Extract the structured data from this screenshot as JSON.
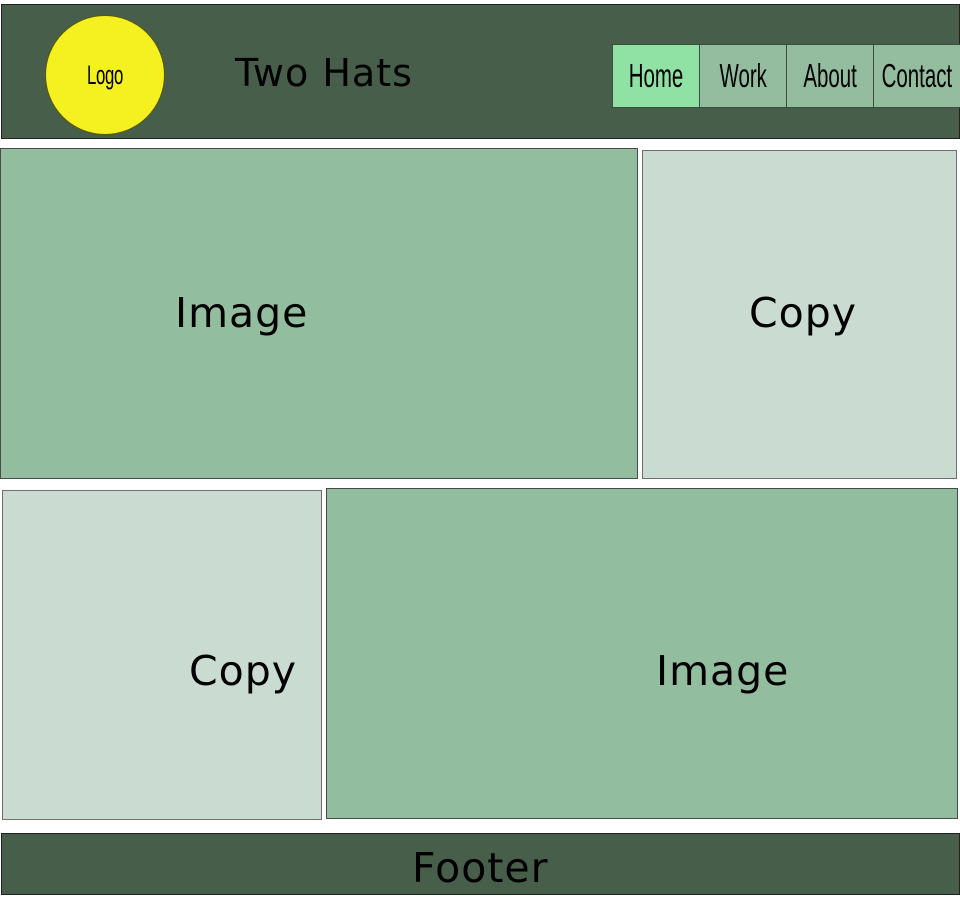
{
  "header": {
    "logo_text": "Logo",
    "site_title": "Two Hats",
    "nav": [
      {
        "label": "Home",
        "active": true
      },
      {
        "label": "Work",
        "active": false
      },
      {
        "label": "About",
        "active": false
      },
      {
        "label": "Contact",
        "active": false
      }
    ]
  },
  "row1": {
    "image_label": "Image",
    "copy_label": "Copy"
  },
  "row2": {
    "copy_label": "Copy",
    "image_label": "Image"
  },
  "footer": {
    "label": "Footer"
  },
  "colors": {
    "header_bg": "#465e4a",
    "logo": "#f5f01f",
    "nav_active": "#8fe2a4",
    "nav_default": "#93bd9e",
    "image_block": "#92bd9e",
    "copy_block": "#cadcd2"
  }
}
